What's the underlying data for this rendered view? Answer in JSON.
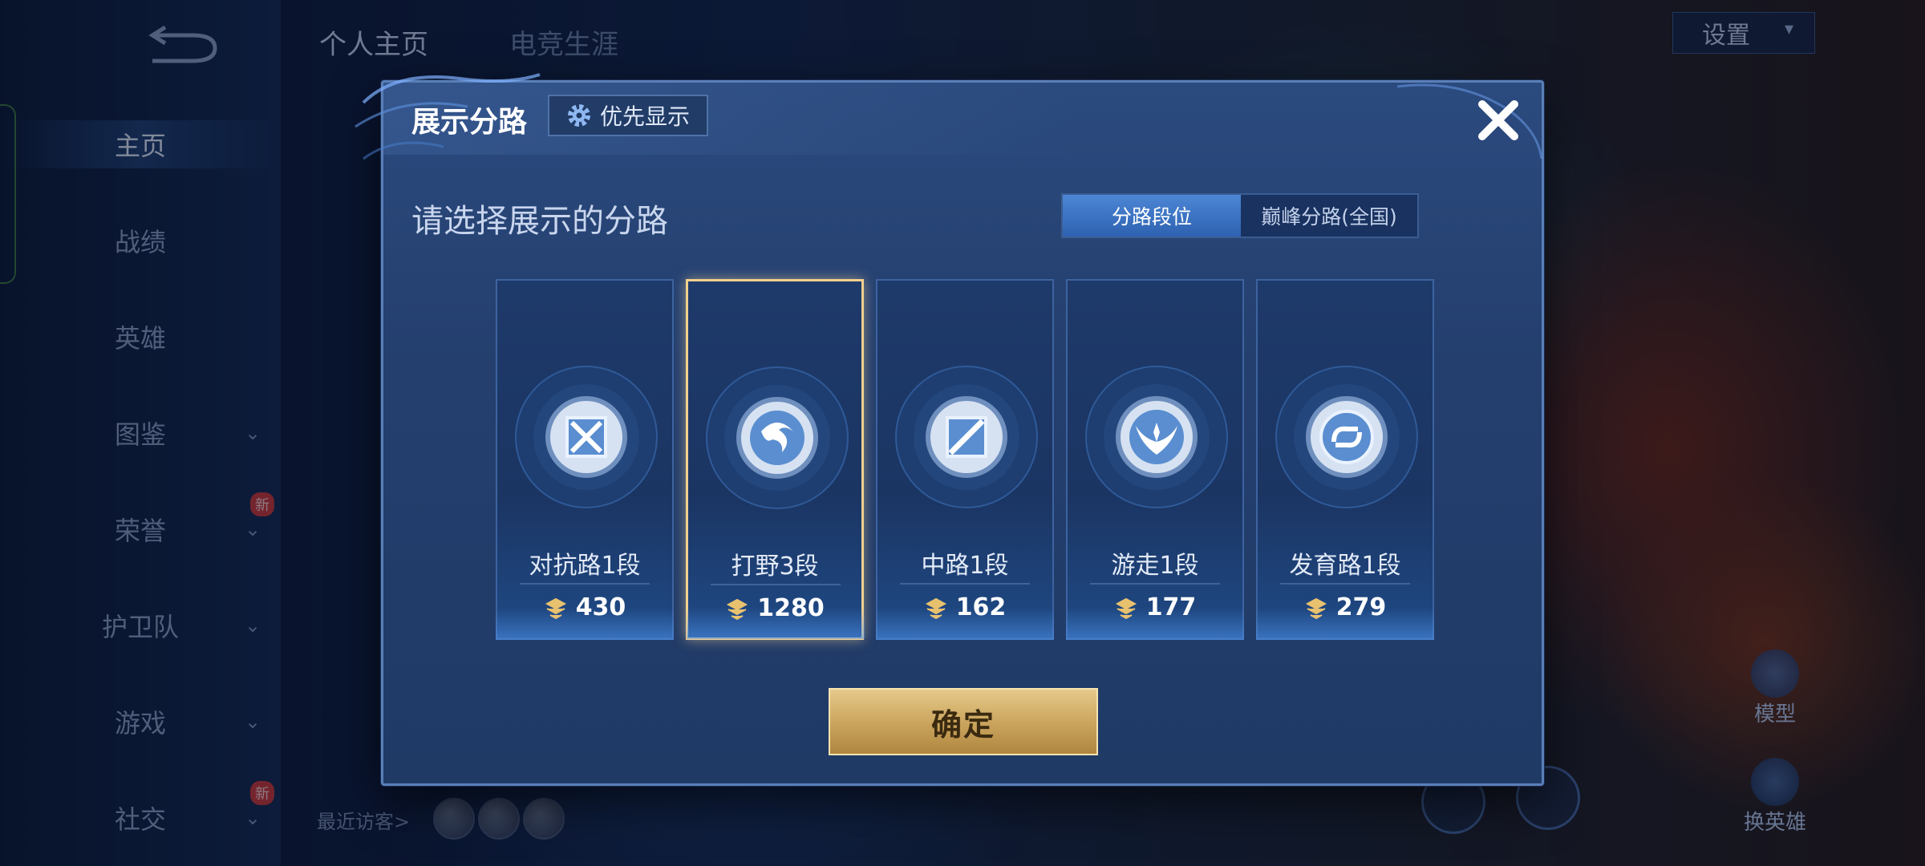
{
  "background": {
    "nav": [
      {
        "label": "主页",
        "active": true,
        "chevron": false,
        "new": false
      },
      {
        "label": "战绩",
        "active": false,
        "chevron": false,
        "new": false
      },
      {
        "label": "英雄",
        "active": false,
        "chevron": false,
        "new": false
      },
      {
        "label": "图鉴",
        "active": false,
        "chevron": true,
        "new": false
      },
      {
        "label": "荣誉",
        "active": false,
        "chevron": true,
        "new": true
      },
      {
        "label": "护卫队",
        "active": false,
        "chevron": true,
        "new": false
      },
      {
        "label": "游戏",
        "active": false,
        "chevron": true,
        "new": false
      },
      {
        "label": "社交",
        "active": false,
        "chevron": true,
        "new": true
      }
    ],
    "new_badge": "新",
    "tabs": [
      "个人主页",
      "电竞生涯"
    ],
    "settings_label": "设置",
    "recent_visitors_label": "最近访客>",
    "model_label": "模型",
    "change_hero_label": "换英雄"
  },
  "dialog": {
    "title": "展示分路",
    "priority_label": "优先显示",
    "subtitle": "请选择展示的分路",
    "toggle": {
      "option1": "分路段位",
      "option2": "巅峰分路(全国)",
      "selected": "分路段位"
    },
    "lanes": [
      {
        "label": "对抗路1段",
        "score": "430",
        "icon": "clash-lane-emblem",
        "selected": false
      },
      {
        "label": "打野3段",
        "score": "1280",
        "icon": "jungle-emblem",
        "selected": true
      },
      {
        "label": "中路1段",
        "score": "162",
        "icon": "mid-lane-emblem",
        "selected": false
      },
      {
        "label": "游走1段",
        "score": "177",
        "icon": "roam-emblem",
        "selected": false
      },
      {
        "label": "发育路1段",
        "score": "279",
        "icon": "farm-lane-emblem",
        "selected": false
      }
    ],
    "confirm_label": "确定"
  },
  "colors": {
    "accent": "#4d86d6",
    "gold": "#c9a35c",
    "selected_border": "#f3d08e"
  }
}
